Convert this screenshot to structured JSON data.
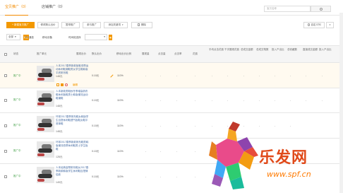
{
  "tabs": [
    {
      "label": "宝贝推广（0）"
    },
    {
      "label": "店铺推广（0）"
    }
  ],
  "search": {
    "placeholder": "宝贝名称"
  },
  "toolbar": {
    "add_label": "+ 新建宝贝推广",
    "buttons": [
      "修改默认出价",
      "暂停推广",
      "参与推广",
      "添加关键词",
      "删除"
    ],
    "download_label": "自定义列"
  },
  "filters": {
    "category_label": "全部",
    "tag_label": "标签",
    "ad_label": "PC通投",
    "device_label": "移动设备",
    "time_label": "时间段选择"
  },
  "table": {
    "headers": [
      "状态",
      "推广单元",
      "展现出价",
      "默认出价",
      "移动出价比例",
      "展现量",
      "点击量",
      "点击率",
      "花费",
      "平均点击花费",
      "千次展现花费",
      "总成交金额",
      "总成交笔数",
      "投入产出比",
      "总收藏数",
      "直接成交金额",
      "间接成交金额",
      "收藏宝贝数",
      "收藏店铺数",
      "总购物车数",
      "投入产出比"
    ],
    "rows": [
      {
        "status": "推广中",
        "title": "人本2017春季新款板鞋低帮运动休闲鞋潮鞋男女学生鞋韩版平底帆布鞋",
        "price": "148元",
        "bid": "0.10元",
        "ratio": "110%",
        "dash": "-"
      },
      {
        "status": "推广中",
        "title": "人本新款男鞋秋冬季增高帆布鞋休闲板鞋男士韩版潮流运动鞋潮鞋",
        "price": "148元",
        "bid": "0.10元",
        "ratio": "110%",
        "dash": "-"
      },
      {
        "status": "推广中",
        "title": "环球2017春季帆布鞋女韩版学生百搭休闲鞋透气板鞋女鞋平底单鞋",
        "price": "148元",
        "bid": "0.10元",
        "ratio": "110%",
        "dash": "-"
      },
      {
        "status": "推广中",
        "title": "环球2017春季新款帆布鞋男韩版潮流低帮休闲鞋男士学生板鞋",
        "price": "128元",
        "bid": "0.10元",
        "ratio": "110%",
        "dash": "-"
      },
      {
        "status": "推广中",
        "title": "人本经典高帮帆布鞋女2017春季新款韩版学生休闲鞋百搭情侣款",
        "price": "149元",
        "bid": "0.10元",
        "ratio": "110%",
        "dash": "-"
      }
    ],
    "row_action": "编辑"
  },
  "watermark": {
    "brand": "乐发网",
    "url": "www.spf.cn"
  },
  "colors": {
    "accent": "#f39800",
    "status": "#43a047",
    "link": "#4a6fa5"
  }
}
